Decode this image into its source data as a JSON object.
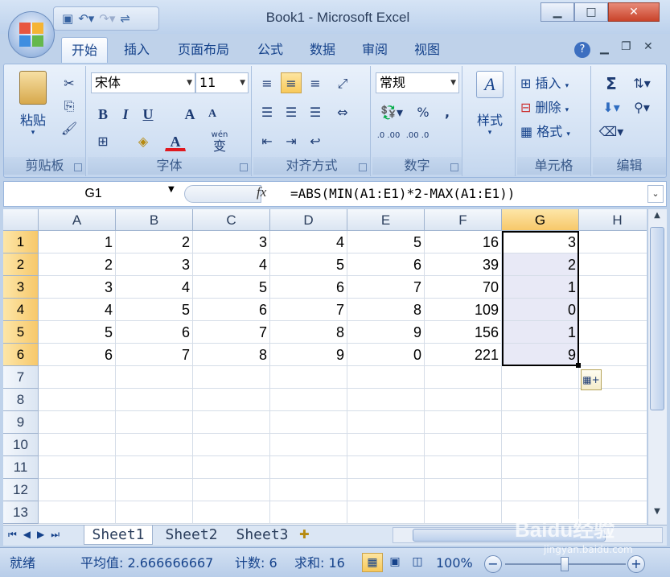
{
  "window": {
    "title": "Book1 - Microsoft Excel",
    "minimize_icon": "minimize-icon",
    "maximize_icon": "maximize-icon",
    "close_icon": "close-icon"
  },
  "quick_access": {
    "save_icon": "save-icon",
    "undo_icon": "undo-icon",
    "redo_icon": "redo-icon",
    "customize_icon": "customize-icon"
  },
  "tabs": [
    "开始",
    "插入",
    "页面布局",
    "公式",
    "数据",
    "审阅",
    "视图"
  ],
  "active_tab": "开始",
  "ribbon": {
    "clipboard": {
      "label": "剪贴板",
      "paste": "粘贴"
    },
    "font": {
      "label": "字体",
      "name": "宋体",
      "size": "11",
      "bold": "B",
      "italic": "I",
      "underline": "U",
      "grow": "A",
      "shrink": "A",
      "font_color": "A",
      "phonetic": "wén",
      "phonetic_char": "变"
    },
    "alignment": {
      "label": "对齐方式"
    },
    "number": {
      "label": "数字",
      "format": "常规",
      "percent": "%",
      "comma": ",",
      "inc_decimal": ".0 .00",
      "dec_decimal": ".00 .0"
    },
    "styles": {
      "label": "样式"
    },
    "cells": {
      "label": "单元格",
      "insert": "插入",
      "delete": "删除",
      "format": "格式"
    },
    "editing": {
      "label": "编辑",
      "sum": "Σ"
    }
  },
  "formula_bar": {
    "name_box": "G1",
    "fx": "fx",
    "formula": "=ABS(MIN(A1:E1)*2-MAX(A1:E1))"
  },
  "columns": [
    "A",
    "B",
    "C",
    "D",
    "E",
    "F",
    "G",
    "H"
  ],
  "selected_column": "G",
  "rows": [
    "1",
    "2",
    "3",
    "4",
    "5",
    "6",
    "7",
    "8",
    "9",
    "10",
    "11",
    "12",
    "13"
  ],
  "cells": [
    [
      "1",
      "2",
      "3",
      "4",
      "5",
      "16",
      "3"
    ],
    [
      "2",
      "3",
      "4",
      "5",
      "6",
      "39",
      "2"
    ],
    [
      "3",
      "4",
      "5",
      "6",
      "7",
      "70",
      "1"
    ],
    [
      "4",
      "5",
      "6",
      "7",
      "8",
      "109",
      "0"
    ],
    [
      "5",
      "6",
      "7",
      "8",
      "9",
      "156",
      "1"
    ],
    [
      "6",
      "7",
      "8",
      "9",
      "0",
      "221",
      "9"
    ]
  ],
  "sheets": [
    "Sheet1",
    "Sheet2",
    "Sheet3"
  ],
  "active_sheet": "Sheet1",
  "status": {
    "mode": "就绪",
    "average": "平均值: 2.666666667",
    "count": "计数: 6",
    "sum": "求和: 16",
    "zoom": "100%"
  },
  "watermark": {
    "brand": "Baidu经验",
    "url": "jingyan.baidu.com"
  },
  "colors": {
    "selection_fill": "#e8e9f6",
    "header_selected": "#f7c86a",
    "accent": "#15428b"
  }
}
